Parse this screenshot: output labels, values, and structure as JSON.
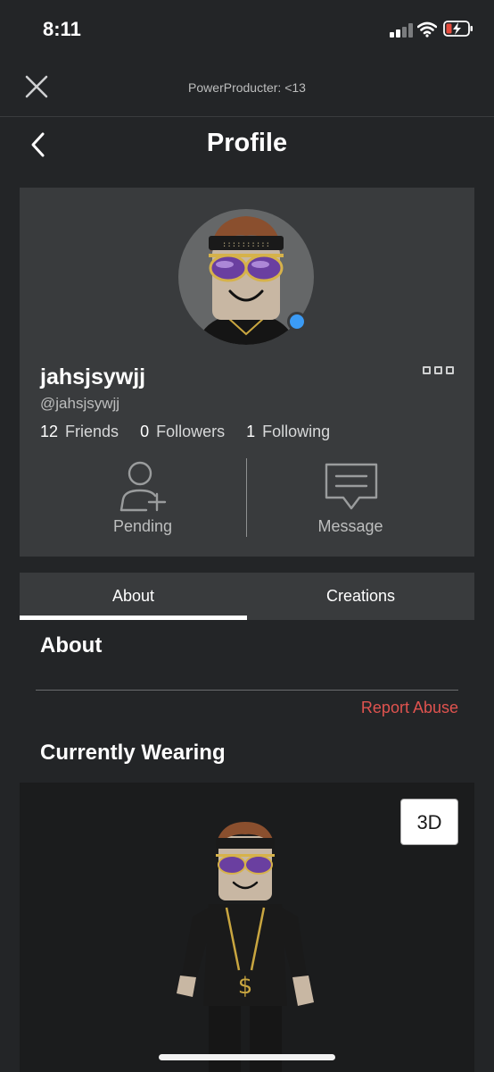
{
  "status_bar": {
    "time": "8:11",
    "icons": [
      "cellular-signal-icon",
      "wifi-icon",
      "battery-charging-icon"
    ]
  },
  "top_bar": {
    "close_icon": "close-icon",
    "title": "PowerProducter: <13"
  },
  "header": {
    "back_icon": "chevron-left-icon",
    "title": "Profile"
  },
  "profile": {
    "display_name": "jahsjsywjj",
    "username": "@jahsjsywjj",
    "online": true,
    "online_color": "#3b9bf5",
    "more_icon": "more-options-icon",
    "stats": [
      {
        "count": "12",
        "label": "Friends"
      },
      {
        "count": "0",
        "label": "Followers"
      },
      {
        "count": "1",
        "label": "Following"
      }
    ],
    "actions": {
      "pending_label": "Pending",
      "pending_icon": "add-friend-icon",
      "message_label": "Message",
      "message_icon": "message-icon"
    }
  },
  "tabs": [
    {
      "label": "About",
      "active": true
    },
    {
      "label": "Creations",
      "active": false
    }
  ],
  "about": {
    "heading": "About",
    "report_label": "Report Abuse",
    "report_color": "#e0534f"
  },
  "wearing": {
    "heading": "Currently Wearing",
    "toggle_3d_label": "3D"
  },
  "colors": {
    "background": "#232527",
    "card": "#393b3d"
  }
}
